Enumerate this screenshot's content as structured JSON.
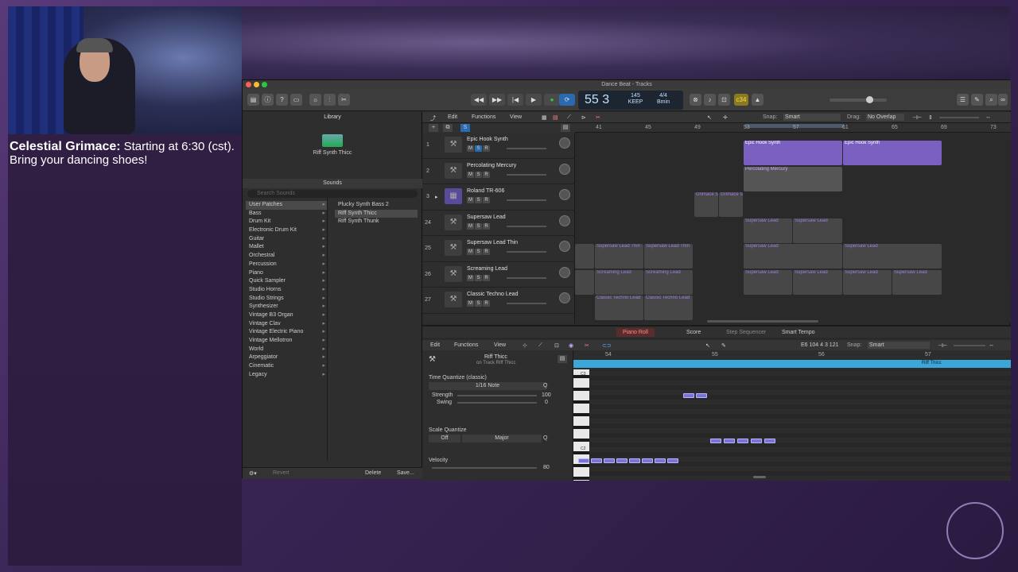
{
  "overlay": {
    "streamer_name": "Celestial Grimace:",
    "caption": "Starting at 6:30 (cst). Bring your dancing shoes!"
  },
  "window": {
    "title": "Dance Beat - Tracks"
  },
  "lcd": {
    "position": "55 3",
    "tempo": "145",
    "tempo_label": "KEEP",
    "signature": "4/4",
    "key": "Bmin"
  },
  "control_bar": {
    "chord_display": "c34"
  },
  "library": {
    "title": "Library",
    "current_patch": "Riff Synth Thicc",
    "sounds_header": "Sounds",
    "search_placeholder": "Search Sounds",
    "categories": [
      "User Patches",
      "Bass",
      "Drum Kit",
      "Electronic Drum Kit",
      "Guitar",
      "Mallet",
      "Orchestral",
      "Percussion",
      "Piano",
      "Quick Sampler",
      "Studio Horns",
      "Studio Strings",
      "Synthesizer",
      "Vintage B3 Organ",
      "Vintage Clav",
      "Vintage Electric Piano",
      "Vintage Mellotron",
      "World",
      "Arpeggiator",
      "Cinematic",
      "Legacy"
    ],
    "patches": [
      "Plucky Synth Bass 2",
      "Riff Synth Thicc",
      "Riff Synth Thunk"
    ],
    "footer": {
      "revert": "Revert",
      "delete": "Delete",
      "save": "Save..."
    }
  },
  "tracks_menu": {
    "edit": "Edit",
    "functions": "Functions",
    "view": "View",
    "snap_label": "Snap:",
    "snap_value": "Smart",
    "drag_label": "Drag:",
    "drag_value": "No Overlap",
    "s_button": "S"
  },
  "ruler": [
    "41",
    "45",
    "49",
    "53",
    "57",
    "61",
    "65",
    "69",
    "73"
  ],
  "tracks": [
    {
      "num": "1",
      "name": "Epic Hook Synth"
    },
    {
      "num": "2",
      "name": "Percolating Mercury"
    },
    {
      "num": "3",
      "name": "Roland TR-606"
    },
    {
      "num": "24",
      "name": "Supersaw Lead"
    },
    {
      "num": "25",
      "name": "Supersaw Lead Thin"
    },
    {
      "num": "26",
      "name": "Screaming Lead"
    },
    {
      "num": "27",
      "name": "Classic Techno Lead"
    }
  ],
  "track_buttons": {
    "mute": "M",
    "solo": "S",
    "record": "R"
  },
  "regions": {
    "epic": "Epic Hook Synth",
    "perc": "Percolating Mercury",
    "grimace": "Grimace S",
    "supersaw": "Supersaw Lead",
    "supersaw_thin": "Supersaw Lead Thin",
    "screaming": "Screaming Lead",
    "classic": "Classic Techno Lead"
  },
  "editor": {
    "tabs": [
      "Piano Roll",
      "Score",
      "Step Sequencer",
      "Smart Tempo"
    ],
    "menu": {
      "edit": "Edit",
      "functions": "Functions",
      "view": "View"
    },
    "readout": "E6  104 4 3 121",
    "snap_label": "Snap:",
    "snap_value": "Smart",
    "region_name": "Riff Thicc",
    "region_track": "on Track Riff Thicc",
    "time_quantize": "Time Quantize (classic)",
    "quantize_value": "1/16 Note",
    "strength_label": "Strength",
    "strength_value": "100",
    "swing_label": "Swing",
    "swing_value": "0",
    "scale_quantize": "Scale Quantize",
    "scale_off": "Off",
    "scale_mode": "Major",
    "q": "Q",
    "velocity_label": "Velocity",
    "velocity_value": "80",
    "ruler": [
      "54",
      "55",
      "56",
      "57"
    ],
    "region_bar_label": "Riff Thicc",
    "key_labels": [
      "C3",
      "C2"
    ]
  }
}
